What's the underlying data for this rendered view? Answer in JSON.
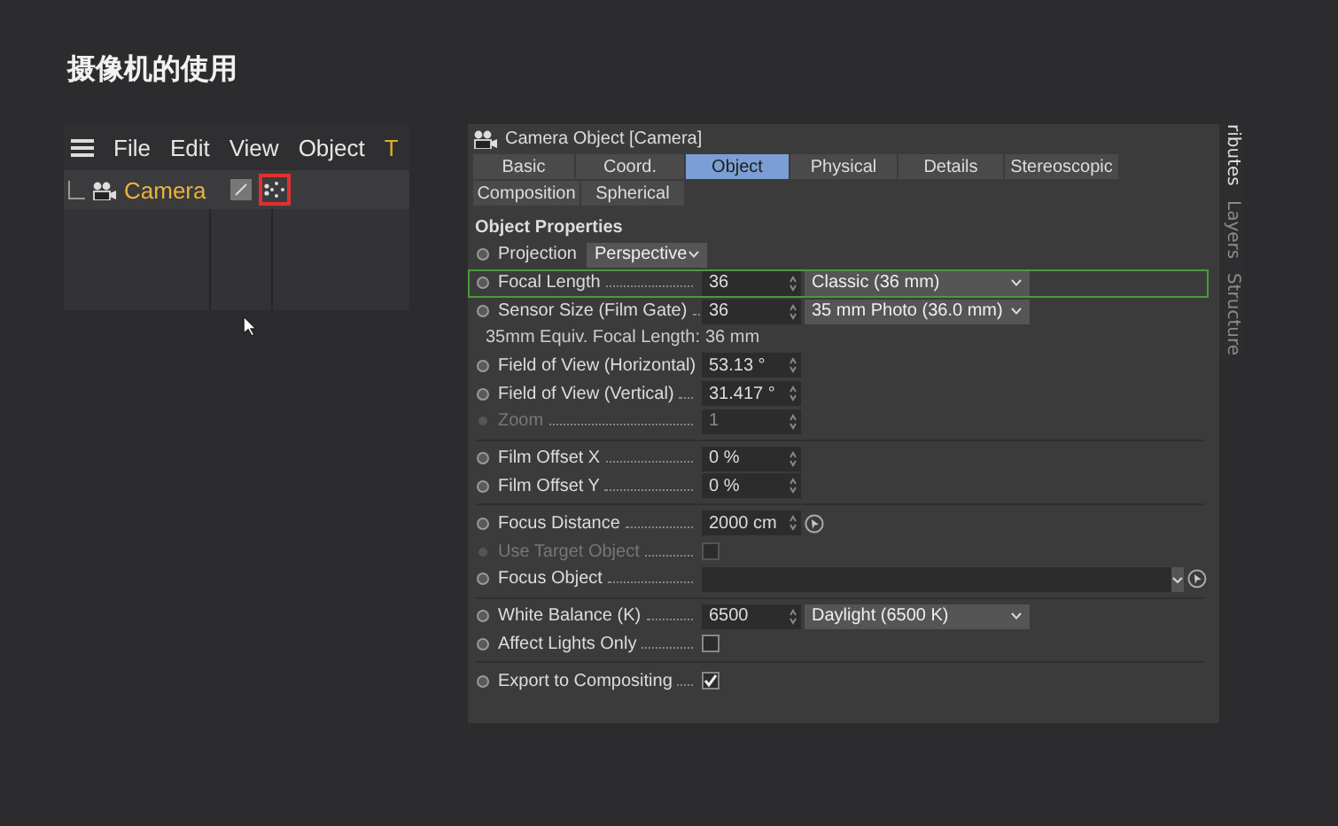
{
  "title": "摄像机的使用",
  "object_manager": {
    "menu": [
      "File",
      "Edit",
      "View",
      "Object",
      "T"
    ],
    "object": {
      "name": "Camera",
      "tag_selected": true
    }
  },
  "attributes": {
    "header": "Camera Object [Camera]",
    "side_tabs": [
      "ributes",
      "Layers",
      "Structure"
    ],
    "tabs": [
      [
        {
          "label": "Basic",
          "selected": false
        },
        {
          "label": "Coord.",
          "selected": false
        },
        {
          "label": "Object",
          "selected": true
        },
        {
          "label": "Physical",
          "selected": false
        },
        {
          "label": "Details",
          "selected": false
        },
        {
          "label": "Stereoscopic",
          "selected": false
        }
      ],
      [
        {
          "label": "Composition",
          "selected": false
        },
        {
          "label": "Spherical",
          "selected": false
        }
      ]
    ],
    "section": "Object Properties",
    "rows": [
      {
        "kind": "select",
        "label": "Projection",
        "value": "Perspective",
        "disabled": false,
        "highlighted": false
      },
      {
        "kind": "number",
        "label": "Focal Length",
        "value": "36",
        "preset": "Classic (36 mm)",
        "disabled": false,
        "highlighted": true
      },
      {
        "kind": "number",
        "label": "Sensor Size (Film Gate)",
        "value": "36",
        "preset": "35 mm Photo (36.0 mm)",
        "disabled": false,
        "highlighted": false
      },
      {
        "kind": "info",
        "label": "35mm Equiv. Focal Length:",
        "value": "36 mm"
      },
      {
        "kind": "number",
        "label": "Field of View (Horizontal)",
        "value": "53.13 °",
        "disabled": false,
        "highlighted": false
      },
      {
        "kind": "number",
        "label": "Field of View (Vertical)",
        "value": "31.417 °",
        "disabled": false,
        "highlighted": false
      },
      {
        "kind": "number",
        "label": "Zoom",
        "value": "1",
        "disabled": true,
        "highlighted": false
      },
      {
        "kind": "separator"
      },
      {
        "kind": "number",
        "label": "Film Offset X",
        "value": "0 %",
        "disabled": false,
        "highlighted": false
      },
      {
        "kind": "number",
        "label": "Film Offset Y",
        "value": "0 %",
        "disabled": false,
        "highlighted": false
      },
      {
        "kind": "separator"
      },
      {
        "kind": "number",
        "label": "Focus Distance",
        "value": "2000 cm",
        "picker": true,
        "disabled": false,
        "highlighted": false
      },
      {
        "kind": "checkbox",
        "label": "Use Target Object",
        "checked": false,
        "disabled": true
      },
      {
        "kind": "link",
        "label": "Focus Object",
        "picker": true,
        "disabled": false
      },
      {
        "kind": "separator"
      },
      {
        "kind": "number",
        "label": "White Balance (K)",
        "value": "6500",
        "preset": "Daylight (6500 K)",
        "disabled": false,
        "highlighted": false
      },
      {
        "kind": "checkbox",
        "label": "Affect Lights Only",
        "checked": false,
        "disabled": false
      },
      {
        "kind": "separator"
      },
      {
        "kind": "checkbox",
        "label": "Export to Compositing",
        "checked": true,
        "disabled": false
      }
    ]
  }
}
